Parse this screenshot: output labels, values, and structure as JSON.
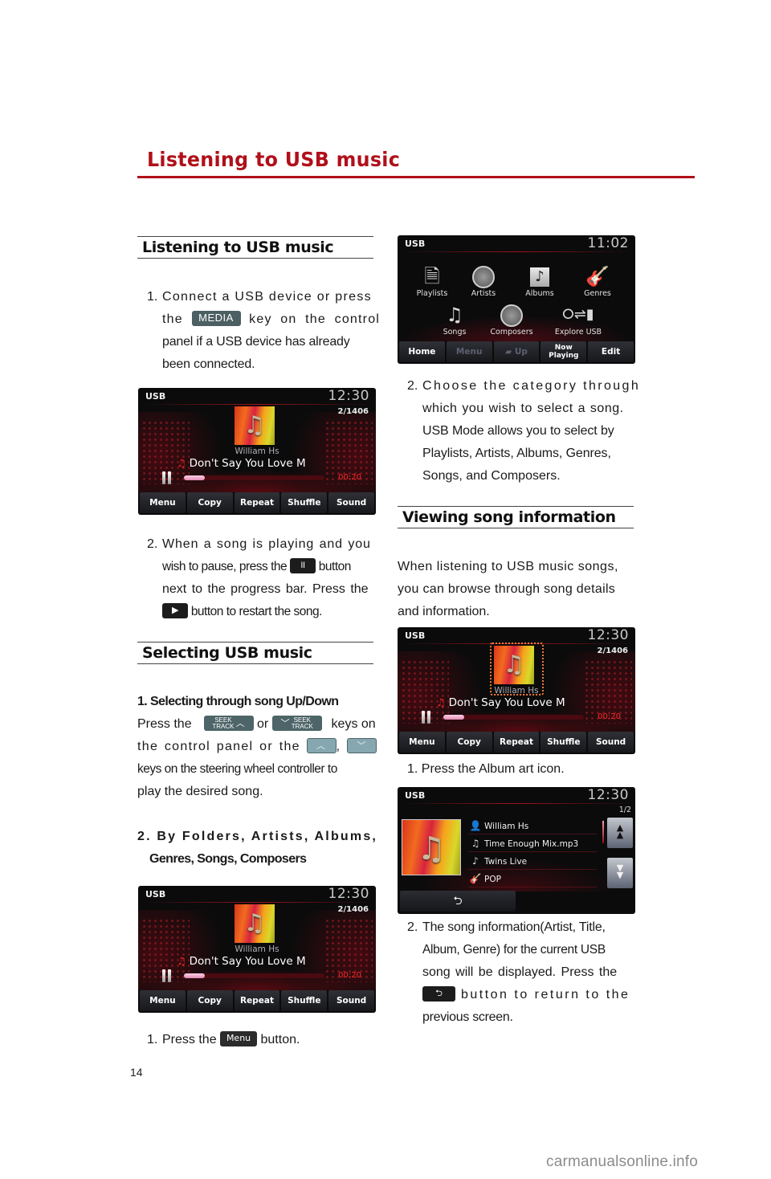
{
  "page": {
    "title": "Listening to USB music",
    "page_number": "14",
    "watermark": "carmanualsonline.info",
    "accent_color": "#b0101a"
  },
  "left": {
    "section1": {
      "heading": "Listening to USB music",
      "step1": {
        "num": "1.",
        "a": "Connect a USB device or press",
        "b_pre": "the",
        "key": "MEDIA",
        "b_post": "key on the control",
        "c": "panel if a USB device has already",
        "d": "been connected."
      },
      "step2": {
        "num": "2.",
        "a": "When a song is playing and you",
        "b_pre": "wish to pause, press the",
        "pause_key": "II",
        "b_post": "button",
        "c": "next to the progress bar. Press the",
        "play_key": "▶",
        "d": "button to restart the song."
      }
    },
    "section2": {
      "heading": "Selecting USB music",
      "sub1": "1. Selecting through song Up/Down",
      "p1_pre": "Press the",
      "seek_up": {
        "top": "SEEK",
        "bottom": "TRACK",
        "arrow": "^"
      },
      "p1_or": "or",
      "seek_down": {
        "top": "SEEK",
        "bottom": "TRACK",
        "arrow": "v"
      },
      "p1_post": "keys on",
      "p2_pre": "the control panel or the",
      "wheel_up": "^",
      "comma": ",",
      "wheel_down": "v",
      "p3": "keys on the steering wheel controller to",
      "p4": "play the desired song.",
      "sub2_a": "2. By Folders, Artists, Albums,",
      "sub2_b": "Genres, Songs, Composers",
      "step_menu": {
        "num": "1.",
        "pre": "Press the",
        "key": "Menu",
        "post": "button."
      }
    }
  },
  "right": {
    "step_choose": {
      "num": "2.",
      "a": "Choose the category through",
      "b": "which you wish to select a song.",
      "c": "USB Mode allows you to select by",
      "d": "Playlists, Artists, Albums, Genres,",
      "e": "Songs, and Composers."
    },
    "section3": {
      "heading": "Viewing song information",
      "intro_a": "When listening to USB music songs,",
      "intro_b": "you can browse through song details",
      "intro_c": "and information.",
      "step1": "1. Press the Album art icon.",
      "step2": {
        "num": "2.",
        "a": "The song information(Artist, Title,",
        "b": "Album, Genre) for the current USB",
        "c": "song will be displayed. Press the",
        "key": "⮌",
        "d_post": "button to return to the",
        "e": "previous screen."
      }
    }
  },
  "player_screen": {
    "source": "USB",
    "clock": "12:30",
    "track": "2/1406",
    "artist": "William Hs",
    "song": "Don't Say You Love M",
    "elapsed": "00:20",
    "progress": 0.15,
    "buttons": [
      "Menu",
      "Copy",
      "Repeat",
      "Shuffle",
      "Sound"
    ]
  },
  "menu_screen": {
    "source": "USB",
    "clock": "11:02",
    "categories": [
      {
        "label": "Playlists",
        "icon": "playlist-icon"
      },
      {
        "label": "Artists",
        "icon": "artist-icon"
      },
      {
        "label": "Albums",
        "icon": "album-icon"
      },
      {
        "label": "Genres",
        "icon": "guitar-icon"
      },
      {
        "label": "Songs",
        "icon": "music-note-icon"
      },
      {
        "label": "Composers",
        "icon": "pen-nib-icon"
      },
      {
        "label": "Explore USB",
        "icon": "usb-icon"
      }
    ],
    "buttons": [
      {
        "label": "Home",
        "enabled": true
      },
      {
        "label": "Menu",
        "enabled": false
      },
      {
        "label": "Up",
        "enabled": false
      },
      {
        "label": "Now Playing",
        "enabled": true
      },
      {
        "label": "Edit",
        "enabled": true
      }
    ]
  },
  "info_screen": {
    "source": "USB",
    "clock": "12:30",
    "page": "1/2",
    "rows": [
      {
        "icon": "artist-icon",
        "glyph": "👤",
        "text": "William Hs"
      },
      {
        "icon": "music-note-icon",
        "glyph": "♫",
        "text": "Time Enough Mix.mp3"
      },
      {
        "icon": "album-icon",
        "glyph": "♪",
        "text": "Twins Live"
      },
      {
        "icon": "guitar-icon",
        "glyph": "🎸",
        "text": "POP"
      }
    ],
    "back_glyph": "⮌",
    "up_glyph": "▲▲",
    "down_glyph": "▼▼"
  }
}
